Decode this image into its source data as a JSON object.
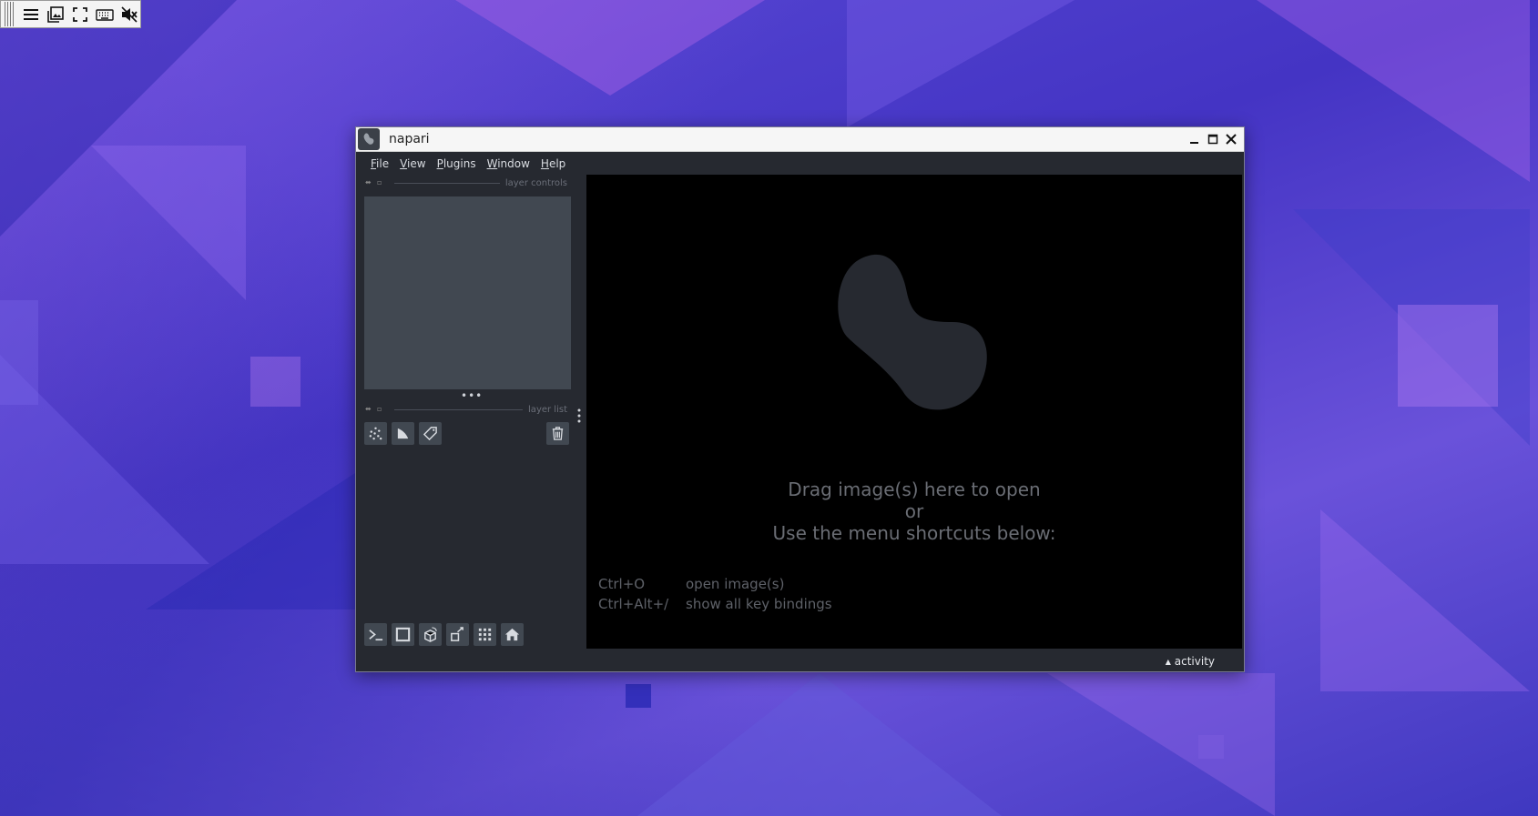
{
  "vnc_toolbar": {
    "icons": [
      "menu-icon",
      "screenshot-icon",
      "fullscreen-icon",
      "keyboard-icon",
      "mute-icon"
    ]
  },
  "window": {
    "title": "napari",
    "icon": "napari-logo-icon",
    "controls": [
      "minimize-icon",
      "maximize-icon",
      "close-icon"
    ]
  },
  "menubar": {
    "items": [
      {
        "label": "File",
        "accel": "F",
        "rest": "ile"
      },
      {
        "label": "View",
        "accel": "V",
        "rest": "iew"
      },
      {
        "label": "Plugins",
        "accel": "P",
        "rest": "lugins"
      },
      {
        "label": "Window",
        "accel": "W",
        "rest": "indow"
      },
      {
        "label": "Help",
        "accel": "H",
        "rest": "elp"
      }
    ]
  },
  "left_dock": {
    "layer_controls_label": "layer controls",
    "layer_list_label": "layer list",
    "layer_buttons": [
      "new-points-layer-icon",
      "new-shapes-layer-icon",
      "new-labels-layer-icon"
    ],
    "delete_button": "delete-layer-icon",
    "bottom_buttons": [
      "console-icon",
      "ndisplay-2d-icon",
      "roll-dims-icon",
      "transpose-dims-icon",
      "grid-view-icon",
      "home-icon"
    ]
  },
  "canvas": {
    "welcome_line1": "Drag image(s) here to open",
    "welcome_line2": "or",
    "welcome_line3": "Use the menu shortcuts below:",
    "shortcuts": [
      {
        "key": "Ctrl+O",
        "desc": "open image(s)"
      },
      {
        "key": "Ctrl+Alt+/",
        "desc": "show all key bindings"
      }
    ]
  },
  "statusbar": {
    "activity_label": "activity"
  },
  "colors": {
    "window_bg": "#262930",
    "panel_bg": "#414851",
    "canvas_bg": "#000000",
    "logo_fill": "#262930"
  }
}
